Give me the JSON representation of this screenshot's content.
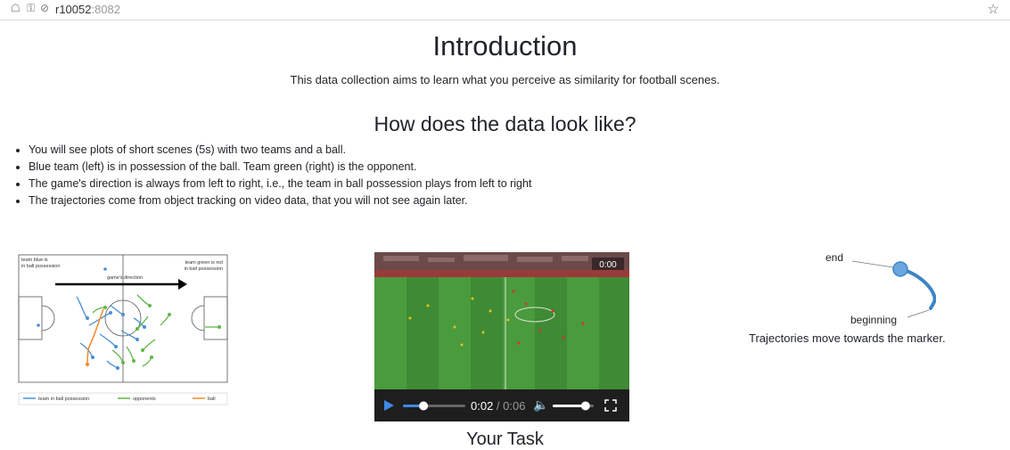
{
  "browser": {
    "url_host": "r10052",
    "url_port": ":8082",
    "icons": [
      "tab-icon",
      "key-icon",
      "tracking-icon",
      "bookmark-star-icon"
    ]
  },
  "intro": {
    "title": "Introduction",
    "description": "This data collection aims to learn what you perceive as similarity for football scenes."
  },
  "data_section": {
    "heading": "How does the data look like?",
    "bullets": [
      "You will see plots of short scenes (5s) with two teams and a ball.",
      "Blue team (left) is in possession of the ball. Team green (right) is the opponent.",
      "The game's direction is always from left to right, i.e., the team in ball possession plays from left to right",
      "The trajectories come from object tracking on video data, that you will not see again later."
    ]
  },
  "pitch_figure": {
    "label_left": [
      "team blue is",
      "in ball possession"
    ],
    "label_right": [
      "team green is not",
      "in ball possession"
    ],
    "direction_label": "game's direction",
    "legend": [
      "team in ball possession",
      "opponents",
      "ball"
    ],
    "colors": {
      "blue": "#4a8fd4",
      "green": "#5fb74a",
      "orange": "#f08a2a"
    }
  },
  "video": {
    "overlay_time": "0:00",
    "current_time": "0:02",
    "duration": "0:06",
    "progress": 0.33,
    "volume": 0.8
  },
  "trajectory_example": {
    "end_label": "end",
    "beginning_label": "beginning",
    "caption": "Trajectories move towards the marker.",
    "color": "#3d85c6"
  },
  "task_section": {
    "heading": "Your Task"
  }
}
